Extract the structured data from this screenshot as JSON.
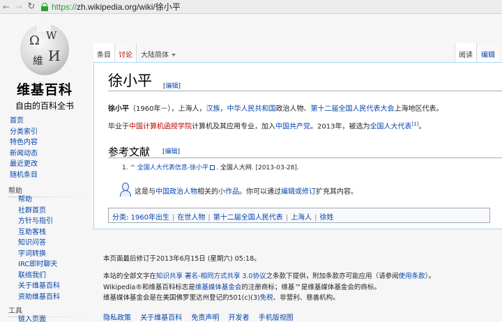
{
  "browser": {
    "back_icon": "back-arrow-icon",
    "forward_icon": "forward-arrow-icon",
    "reload_icon": "reload-icon",
    "url_scheme": "https://",
    "url_rest": "zh.wikipedia.org/wiki/徐小平"
  },
  "logo": {
    "title": "维基百科",
    "subtitle": "自由的百科全书"
  },
  "sidebar": {
    "nav": [
      "首页",
      "分类索引",
      "特色内容",
      "新闻动态",
      "最近更改",
      "随机条目"
    ],
    "help_heading": "帮助",
    "help": [
      "帮助",
      "社群首页",
      "方针与指引",
      "互助客栈",
      "知识问答",
      "字词转换",
      "IRC即时聊天",
      "联络我们",
      "关于维基百科",
      "资助维基百科"
    ],
    "tools_heading": "工具",
    "tools": [
      "链入页面"
    ]
  },
  "tabs": {
    "article": "条目",
    "talk": "讨论",
    "variant": "大陆简体",
    "read": "阅读",
    "edit": "编辑"
  },
  "article": {
    "title": "徐小平",
    "edit_label": "编辑",
    "p1": {
      "bold": "徐小平",
      "t1": "（1960年－），上海人，",
      "l1": "汉族",
      "t2": "，",
      "l2": "中华人民共和国",
      "t3": "政治人物、",
      "l3": "第十二届全国人民代表大会",
      "t4": "上海地区代表。"
    },
    "p2": {
      "t1": "毕业于",
      "l1": "中国计算机函授学院",
      "t2": "计算机及其应用专业，加入",
      "l2": "中国共产党",
      "t3": "。2013年，被选为",
      "l3": "全国人大代表",
      "ref": "[1]",
      "t4": "。"
    },
    "ref_heading": "参考文献",
    "ref_item": {
      "num": "1.",
      "caret": "^",
      "link": "全国人大代表信息-徐小平",
      "rest": ". 全国人大网. [2013-03-28]."
    },
    "stub": {
      "t1": "这是与",
      "l1": "中国政治人物",
      "t2": "相关的",
      "l2": "小作品",
      "t3": "。你可以通过",
      "l3": "编辑或修订",
      "t4": "扩充其内容。"
    },
    "categories_label": "分类",
    "categories": [
      "1960年出生",
      "在世人物",
      "第十二届全国人民代表",
      "上海人",
      "徐姓"
    ]
  },
  "footer": {
    "modified": "本页面最后修订于2013年6月15日 (星期六) 05:18。",
    "license_t1": "本站的全部文字在",
    "license_l1": "知识共享 署名-相同方式共享 3.0协议",
    "license_t2": "之条款下提供，附加条款亦可能应用（请参阅",
    "license_l2": "使用条款",
    "license_t3": "）。",
    "trademark_t1": "Wikipedia®和维基百科标志是",
    "trademark_l1": "维基媒体基金会",
    "trademark_t2": "的注册商标；维基™是维基媒体基金会的商标。",
    "foundation_t1": "维基媒体基金会是在美国佛罗里达州登记的501(c)(3)",
    "foundation_l1": "免税",
    "foundation_t2": "、非营利、慈善机构。",
    "links": [
      "隐私政策",
      "关于维基百科",
      "免责声明",
      "开发者",
      "手机版视图"
    ]
  }
}
